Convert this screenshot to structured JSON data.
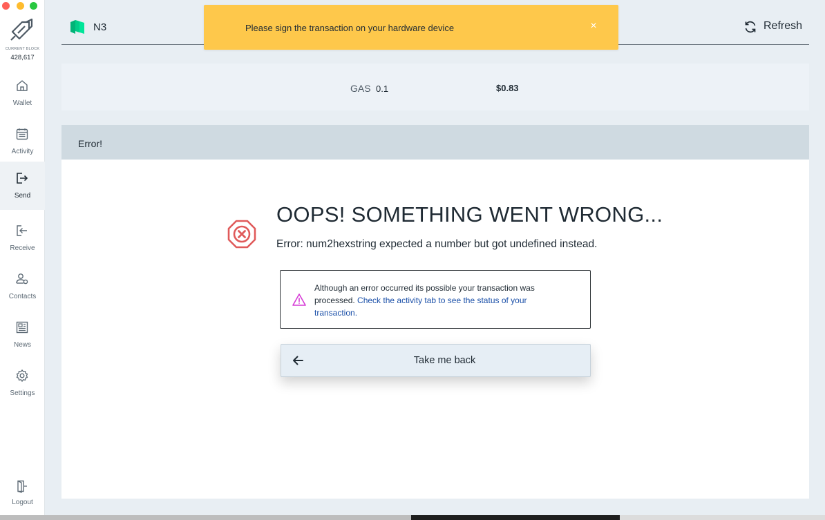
{
  "sidebar": {
    "current_block_label": "CURRENT BLOCK",
    "current_block_value": "428,617",
    "items": [
      {
        "label": "Wallet",
        "icon": "home-icon"
      },
      {
        "label": "Activity",
        "icon": "calendar-icon"
      },
      {
        "label": "Send",
        "icon": "send-icon"
      },
      {
        "label": "Receive",
        "icon": "receive-icon"
      },
      {
        "label": "Contacts",
        "icon": "contacts-icon"
      },
      {
        "label": "News",
        "icon": "news-icon"
      },
      {
        "label": "Settings",
        "icon": "gear-icon"
      }
    ],
    "logout_label": "Logout"
  },
  "header": {
    "network": "N3",
    "refresh_label": "Refresh"
  },
  "toast": {
    "message": "Please sign the transaction on your hardware device",
    "close_symbol": "×"
  },
  "summary": {
    "asset": "GAS",
    "amount": "0.1",
    "value": "$0.83"
  },
  "panel": {
    "title": "Error!",
    "heading": "OOPS! SOMETHING WENT WRONG...",
    "message": "Error: num2hexstring expected a number but got undefined instead.",
    "warning_text": "Although an error occurred its possible your transaction was processed.",
    "warning_link": "Check the activity tab to see the status of your transaction.",
    "back_button": "Take me back"
  },
  "colors": {
    "toast_bg": "#fec84b",
    "error_red": "#e05a5a",
    "warning_magenta": "#d63bd6",
    "link_blue": "#1a4fa8",
    "network_green": "#00d18f"
  }
}
